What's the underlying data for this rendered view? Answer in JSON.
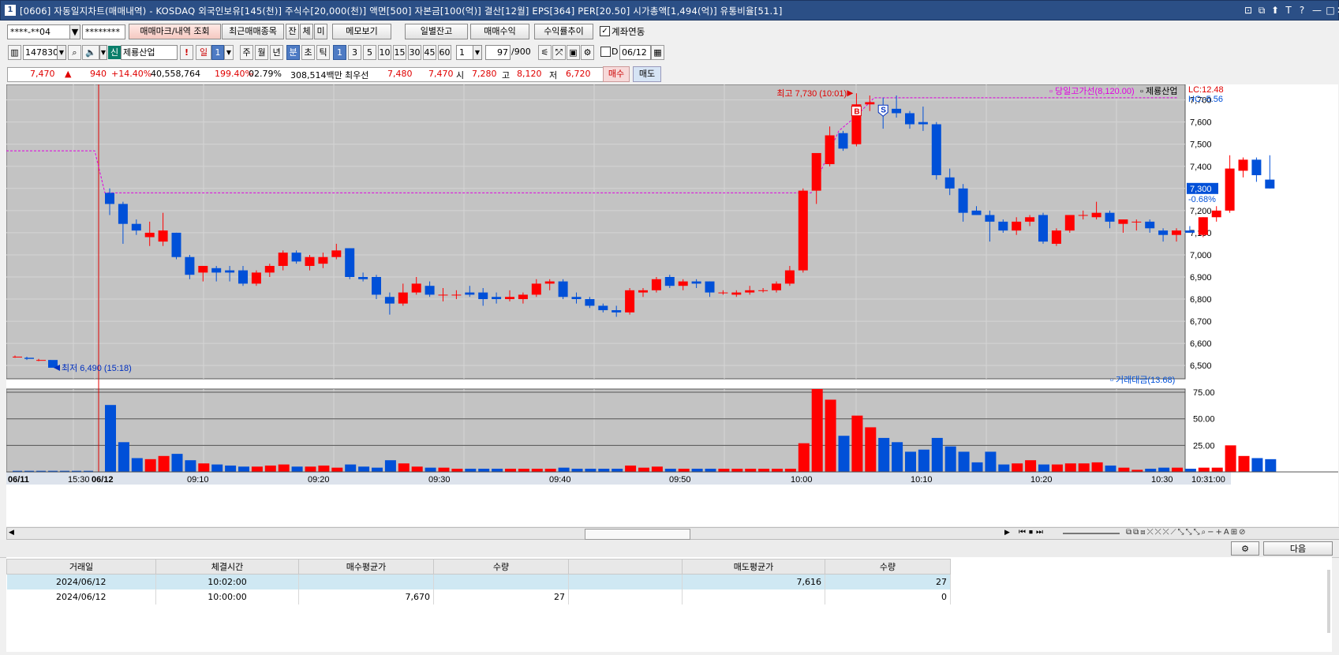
{
  "window": {
    "icon_label": "1",
    "title": "[0606] 자동일지차트(매매내역) - KOSDAQ 외국인보유[145(천)] 주식수[20,000(천)] 액면[500] 자본금[100(억)] 결산[12월] EPS[364] PER[20.50] 시가총액[1,494(억)] 유통비율[51.1]",
    "controls": [
      "⊡",
      "⧉",
      "⬆",
      "T",
      "?",
      "—",
      "□",
      "✕"
    ]
  },
  "toolbar1": {
    "account": "****-**04",
    "password": "********",
    "btn_trade_mark": "매매마크/내역 조회",
    "btn_recent": "최근매매종목",
    "btn_jan": "잔",
    "btn_che": "체",
    "btn_mi": "미",
    "btn_memo": "메모보기",
    "btn_daily_balance": "일별잔고",
    "btn_profit": "매매수익",
    "btn_return": "수익률추이",
    "link_account_label": "계좌연동",
    "link_account_checked": true
  },
  "toolbar2": {
    "code": "147830",
    "badge": "신",
    "stock_name": "제룡산업",
    "exclaim": "!",
    "period_day": "일",
    "period_value": "1",
    "periods": [
      "주",
      "월",
      "년",
      "분",
      "초",
      "틱"
    ],
    "period_active": "분",
    "intervals": [
      "1",
      "3",
      "5",
      "10",
      "15",
      "30",
      "45",
      "60"
    ],
    "interval_active": "1",
    "count_select": "1",
    "count_current": "97",
    "count_max": "/900",
    "date_checkbox": "D",
    "date_value": "06/12"
  },
  "pricebar": {
    "price": "7,470",
    "arrow": "▲",
    "change": "940",
    "change_pct": "+14.40%",
    "volume": "40,558,764",
    "vol_ratio": "199.40%",
    "turnover_pct": "02.79%",
    "amount": "308,514백만",
    "best_ask_label": "최우선",
    "best_ask": "7,480",
    "best_bid": "7,470",
    "open_label": "시",
    "open": "7,280",
    "high_label": "고",
    "high": "8,120",
    "low_label": "저",
    "low": "6,720",
    "buy_btn": "매수",
    "sell_btn": "매도"
  },
  "chart_data": {
    "type": "candlestick",
    "stock_label": "제룡산업",
    "high_line_legend": "당일고가선(8,120.00)",
    "lc_label": "LC:12.48",
    "hc_label": "HC:-5.56",
    "current_price_label": "7,300",
    "current_pct_label": "-0.68%",
    "high_annotation": "최고 7,730 (10:01)",
    "low_annotation": "최저 6,490 (15:18)",
    "buy_marker": "B",
    "sell_marker": "S",
    "price_ticks": [
      "7,700",
      "7,600",
      "7,500",
      "7,400",
      "7,300",
      "7,200",
      "7,100",
      "7,000",
      "6,900",
      "6,800",
      "6,700",
      "6,600",
      "6,500"
    ],
    "price_tick_values": [
      7700,
      7600,
      7500,
      7400,
      7300,
      7200,
      7100,
      7000,
      6900,
      6800,
      6700,
      6600,
      6500
    ],
    "ylim": [
      6440,
      7770
    ],
    "volume_legend": "거래대금(13.68)",
    "volume_ticks": [
      "75.00",
      "50.00",
      "25.00"
    ],
    "volume_tick_values": [
      75,
      50,
      25
    ],
    "volume_ylim": [
      0,
      78
    ],
    "x_labels": [
      "06/11",
      "15:30",
      "06/12",
      "09:10",
      "09:20",
      "09:30",
      "09:40",
      "09:50",
      "10:00",
      "10:10",
      "10:20",
      "10:30",
      "10:31:00"
    ],
    "prev_day_candles": [
      {
        "o": 6540,
        "h": 6545,
        "l": 6535,
        "c": 6540
      },
      {
        "o": 6535,
        "h": 6540,
        "l": 6525,
        "c": 6530
      },
      {
        "o": 6525,
        "h": 6530,
        "l": 6520,
        "c": 6525
      },
      {
        "o": 6525,
        "h": 6525,
        "l": 6490,
        "c": 6490
      }
    ],
    "candles": [
      {
        "o": 7280,
        "h": 7300,
        "l": 7180,
        "c": 7230
      },
      {
        "o": 7230,
        "h": 7240,
        "l": 7050,
        "c": 7140
      },
      {
        "o": 7140,
        "h": 7160,
        "l": 7090,
        "c": 7110
      },
      {
        "o": 7080,
        "h": 7150,
        "l": 7040,
        "c": 7100
      },
      {
        "o": 7060,
        "h": 7190,
        "l": 7040,
        "c": 7110
      },
      {
        "o": 7100,
        "h": 7100,
        "l": 6980,
        "c": 6990
      },
      {
        "o": 6990,
        "h": 7000,
        "l": 6890,
        "c": 6910
      },
      {
        "o": 6920,
        "h": 6950,
        "l": 6880,
        "c": 6950
      },
      {
        "o": 6940,
        "h": 6950,
        "l": 6880,
        "c": 6920
      },
      {
        "o": 6930,
        "h": 6950,
        "l": 6880,
        "c": 6920
      },
      {
        "o": 6930,
        "h": 6950,
        "l": 6860,
        "c": 6870
      },
      {
        "o": 6870,
        "h": 6930,
        "l": 6860,
        "c": 6920
      },
      {
        "o": 6920,
        "h": 6960,
        "l": 6900,
        "c": 6950
      },
      {
        "o": 6950,
        "h": 7020,
        "l": 6930,
        "c": 7010
      },
      {
        "o": 7010,
        "h": 7020,
        "l": 6960,
        "c": 6970
      },
      {
        "o": 6950,
        "h": 7000,
        "l": 6930,
        "c": 6990
      },
      {
        "o": 6960,
        "h": 7010,
        "l": 6940,
        "c": 6990
      },
      {
        "o": 6990,
        "h": 7050,
        "l": 6980,
        "c": 7020
      },
      {
        "o": 7030,
        "h": 7030,
        "l": 6890,
        "c": 6900
      },
      {
        "o": 6900,
        "h": 6920,
        "l": 6880,
        "c": 6890
      },
      {
        "o": 6900,
        "h": 6910,
        "l": 6800,
        "c": 6820
      },
      {
        "o": 6810,
        "h": 6830,
        "l": 6730,
        "c": 6780
      },
      {
        "o": 6780,
        "h": 6870,
        "l": 6770,
        "c": 6830
      },
      {
        "o": 6830,
        "h": 6900,
        "l": 6820,
        "c": 6870
      },
      {
        "o": 6860,
        "h": 6880,
        "l": 6810,
        "c": 6820
      },
      {
        "o": 6820,
        "h": 6850,
        "l": 6790,
        "c": 6820
      },
      {
        "o": 6820,
        "h": 6840,
        "l": 6800,
        "c": 6820
      },
      {
        "o": 6830,
        "h": 6860,
        "l": 6810,
        "c": 6820
      },
      {
        "o": 6830,
        "h": 6850,
        "l": 6770,
        "c": 6800
      },
      {
        "o": 6810,
        "h": 6830,
        "l": 6780,
        "c": 6800
      },
      {
        "o": 6800,
        "h": 6840,
        "l": 6790,
        "c": 6810
      },
      {
        "o": 6800,
        "h": 6830,
        "l": 6780,
        "c": 6820
      },
      {
        "o": 6820,
        "h": 6890,
        "l": 6810,
        "c": 6870
      },
      {
        "o": 6870,
        "h": 6890,
        "l": 6840,
        "c": 6880
      },
      {
        "o": 6880,
        "h": 6890,
        "l": 6800,
        "c": 6810
      },
      {
        "o": 6810,
        "h": 6830,
        "l": 6780,
        "c": 6800
      },
      {
        "o": 6800,
        "h": 6810,
        "l": 6760,
        "c": 6770
      },
      {
        "o": 6770,
        "h": 6780,
        "l": 6740,
        "c": 6750
      },
      {
        "o": 6750,
        "h": 6770,
        "l": 6720,
        "c": 6740
      },
      {
        "o": 6740,
        "h": 6850,
        "l": 6730,
        "c": 6840
      },
      {
        "o": 6830,
        "h": 6850,
        "l": 6810,
        "c": 6840
      },
      {
        "o": 6840,
        "h": 6900,
        "l": 6830,
        "c": 6890
      },
      {
        "o": 6900,
        "h": 6910,
        "l": 6850,
        "c": 6860
      },
      {
        "o": 6860,
        "h": 6890,
        "l": 6840,
        "c": 6880
      },
      {
        "o": 6880,
        "h": 6890,
        "l": 6850,
        "c": 6870
      },
      {
        "o": 6880,
        "h": 6880,
        "l": 6810,
        "c": 6830
      },
      {
        "o": 6830,
        "h": 6840,
        "l": 6820,
        "c": 6830
      },
      {
        "o": 6820,
        "h": 6840,
        "l": 6810,
        "c": 6830
      },
      {
        "o": 6830,
        "h": 6860,
        "l": 6820,
        "c": 6840
      },
      {
        "o": 6840,
        "h": 6850,
        "l": 6830,
        "c": 6840
      },
      {
        "o": 6840,
        "h": 6880,
        "l": 6830,
        "c": 6870
      },
      {
        "o": 6870,
        "h": 6950,
        "l": 6860,
        "c": 6930
      },
      {
        "o": 6930,
        "h": 7300,
        "l": 6920,
        "c": 7290
      },
      {
        "o": 7290,
        "h": 7410,
        "l": 7230,
        "c": 7460
      },
      {
        "o": 7410,
        "h": 7580,
        "l": 7400,
        "c": 7540
      },
      {
        "o": 7550,
        "h": 7560,
        "l": 7470,
        "c": 7480
      },
      {
        "o": 7500,
        "h": 7730,
        "l": 7490,
        "c": 7680
      },
      {
        "o": 7680,
        "h": 7720,
        "l": 7650,
        "c": 7690
      },
      {
        "o": 7660,
        "h": 7710,
        "l": 7570,
        "c": 7640
      },
      {
        "o": 7660,
        "h": 7720,
        "l": 7620,
        "c": 7640
      },
      {
        "o": 7640,
        "h": 7650,
        "l": 7570,
        "c": 7590
      },
      {
        "o": 7600,
        "h": 7670,
        "l": 7560,
        "c": 7590
      },
      {
        "o": 7590,
        "h": 7600,
        "l": 7340,
        "c": 7360
      },
      {
        "o": 7350,
        "h": 7390,
        "l": 7270,
        "c": 7300
      },
      {
        "o": 7300,
        "h": 7320,
        "l": 7150,
        "c": 7190
      },
      {
        "o": 7200,
        "h": 7220,
        "l": 7180,
        "c": 7180
      },
      {
        "o": 7180,
        "h": 7200,
        "l": 7060,
        "c": 7150
      },
      {
        "o": 7150,
        "h": 7160,
        "l": 7100,
        "c": 7110
      },
      {
        "o": 7110,
        "h": 7170,
        "l": 7090,
        "c": 7150
      },
      {
        "o": 7150,
        "h": 7180,
        "l": 7130,
        "c": 7170
      },
      {
        "o": 7180,
        "h": 7190,
        "l": 7050,
        "c": 7060
      },
      {
        "o": 7050,
        "h": 7120,
        "l": 7040,
        "c": 7110
      },
      {
        "o": 7110,
        "h": 7180,
        "l": 7100,
        "c": 7180
      },
      {
        "o": 7180,
        "h": 7200,
        "l": 7160,
        "c": 7180
      },
      {
        "o": 7170,
        "h": 7240,
        "l": 7160,
        "c": 7190
      },
      {
        "o": 7190,
        "h": 7200,
        "l": 7120,
        "c": 7150
      },
      {
        "o": 7140,
        "h": 7160,
        "l": 7100,
        "c": 7160
      },
      {
        "o": 7150,
        "h": 7160,
        "l": 7110,
        "c": 7150
      },
      {
        "o": 7150,
        "h": 7160,
        "l": 7100,
        "c": 7120
      },
      {
        "o": 7110,
        "h": 7120,
        "l": 7060,
        "c": 7090
      },
      {
        "o": 7090,
        "h": 7120,
        "l": 7060,
        "c": 7110
      },
      {
        "o": 7110,
        "h": 7130,
        "l": 7100,
        "c": 7100
      },
      {
        "o": 7090,
        "h": 7170,
        "l": 7080,
        "c": 7170
      },
      {
        "o": 7170,
        "h": 7220,
        "l": 7150,
        "c": 7200
      },
      {
        "o": 7200,
        "h": 7450,
        "l": 7190,
        "c": 7390
      },
      {
        "o": 7380,
        "h": 7440,
        "l": 7350,
        "c": 7430
      },
      {
        "o": 7430,
        "h": 7440,
        "l": 7330,
        "c": 7360
      },
      {
        "o": 7340,
        "h": 7450,
        "l": 7300,
        "c": 7300
      }
    ],
    "volumes_prev": [
      1,
      1,
      1,
      1,
      1,
      1,
      1
    ],
    "volumes": [
      63,
      28,
      13,
      12,
      15,
      17,
      11,
      8,
      7,
      6,
      5,
      5,
      6,
      7,
      5,
      5,
      6,
      4,
      7,
      5,
      4,
      11,
      8,
      5,
      4,
      4,
      3,
      3,
      3,
      3,
      3,
      3,
      3,
      3,
      4,
      3,
      3,
      3,
      3,
      6,
      4,
      5,
      3,
      3,
      3,
      3,
      3,
      3,
      3,
      3,
      3,
      3,
      27,
      78,
      68,
      34,
      53,
      42,
      32,
      28,
      19,
      21,
      32,
      24,
      19,
      9,
      19,
      7,
      8,
      11,
      7,
      7,
      8,
      8,
      9,
      6,
      4,
      2,
      3,
      4,
      4,
      3,
      4,
      4,
      25,
      15,
      13,
      12
    ]
  },
  "scroll_toolbar": {
    "next_btn": "다음"
  },
  "trade_table": {
    "headers": [
      "거래일",
      "체결시간",
      "매수평균가",
      "수량",
      "",
      "매도평균가",
      "수량"
    ],
    "rows": [
      [
        "2024/06/12",
        "10:02:00",
        "",
        "",
        "",
        "7,616",
        "27"
      ],
      [
        "2024/06/12",
        "10:00:00",
        "7,670",
        "27",
        "",
        "",
        "0"
      ]
    ]
  }
}
